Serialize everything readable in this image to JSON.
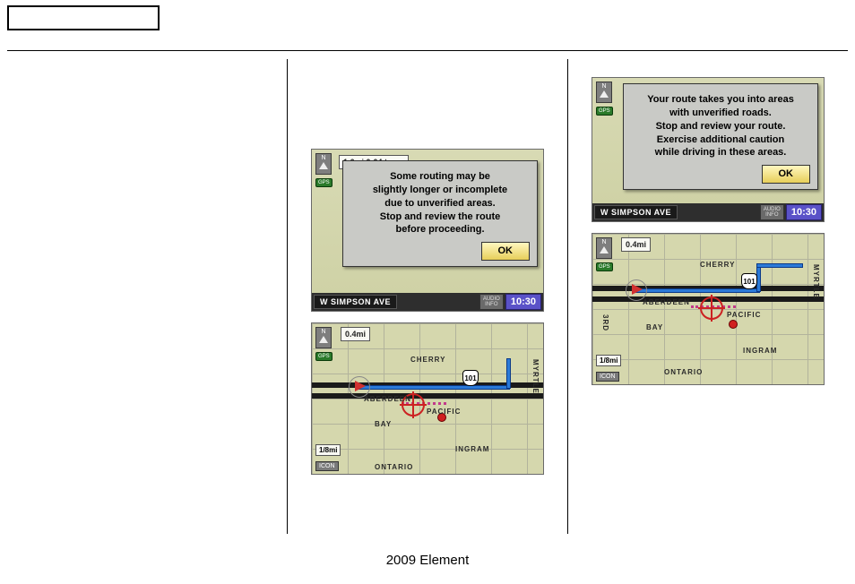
{
  "footer": "2009  Element",
  "screen1": {
    "compass": "N",
    "gps": "GPS",
    "distance": "1.6mi 0:04 to go",
    "dialog": "Some routing may be\nslightly longer or incomplete\ndue to unverified areas.\nStop and review the route\nbefore proceeding.",
    "ok": "OK",
    "street": "W SIMPSON AVE",
    "audio": "AUDIO\nINFO",
    "clock": "10:30"
  },
  "map1": {
    "compass": "N",
    "gps": "GPS",
    "distance": "0.4mi",
    "scale": "1/8mi",
    "icon_btn": "ICON",
    "hwy": "101",
    "labels": {
      "cherry": "CHERRY",
      "aberdeen": "ABERDEEN",
      "pacific": "PACIFIC",
      "bay": "BAY",
      "ingram": "INGRAM",
      "ontario": "ONTARIO",
      "myrtle": "MYRTLE"
    }
  },
  "screen2": {
    "compass": "N",
    "gps": "GPS",
    "dialog": "Your route takes you into areas\nwith unverified roads.\nStop and review your route.\nExercise additional caution\nwhile driving in these areas.",
    "ok": "OK",
    "street": "W SIMPSON AVE",
    "audio": "AUDIO\nINFO",
    "clock": "10:30"
  },
  "map2": {
    "compass": "N",
    "gps": "GPS",
    "distance": "0.4mi",
    "scale": "1/8mi",
    "icon_btn": "ICON",
    "hwy": "101",
    "labels": {
      "cherry": "CHERRY",
      "aberdeen": "ABERDEEN",
      "pacific": "PACIFIC",
      "bay": "BAY",
      "ingram": "INGRAM",
      "ontario": "ONTARIO",
      "myrtle": "MYRTLE",
      "third": "3RD"
    }
  }
}
